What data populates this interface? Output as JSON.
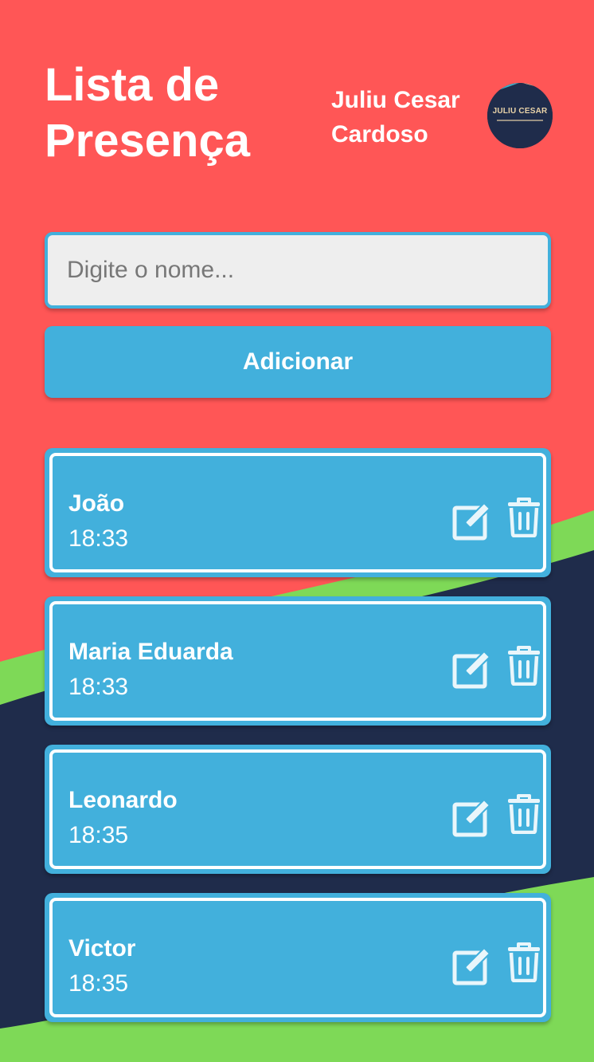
{
  "header": {
    "title": "Lista de Presença",
    "user_name": "Juliu Cesar Cardoso",
    "avatar_text": "JULIU CESAR"
  },
  "form": {
    "placeholder": "Digite o nome...",
    "value": "",
    "add_label": "Adicionar"
  },
  "attendees": [
    {
      "name": "João",
      "time": "18:33"
    },
    {
      "name": "Maria Eduarda",
      "time": "18:33"
    },
    {
      "name": "Leonardo",
      "time": "18:35"
    },
    {
      "name": "Victor",
      "time": "18:35"
    }
  ],
  "icons": {
    "edit": "edit-icon",
    "delete": "trash-icon"
  },
  "colors": {
    "background": "#ff5656",
    "accent": "#42b0dc",
    "wave_green": "#7ed957",
    "wave_navy": "#1f2c4b",
    "input_bg": "#eeeeee"
  }
}
